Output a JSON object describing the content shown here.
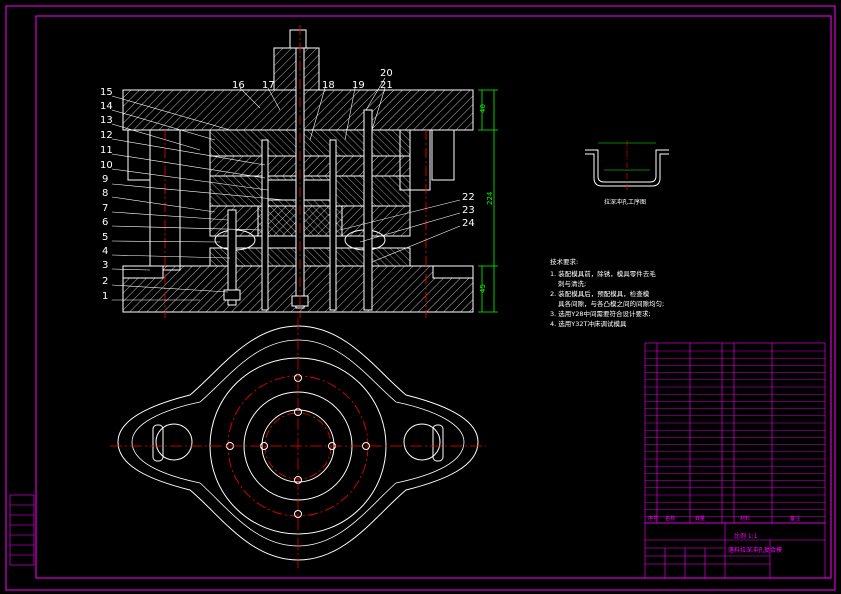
{
  "part_numbers_left": [
    "15",
    "14",
    "13",
    "12",
    "11",
    "10",
    "9",
    "8",
    "7",
    "6",
    "5",
    "4",
    "3",
    "2",
    "1"
  ],
  "part_numbers_top": [
    "16",
    "17",
    "18",
    "19",
    "20",
    "21"
  ],
  "part_numbers_right": [
    "22",
    "23",
    "24"
  ],
  "dimensions": {
    "upper": "40",
    "total": "224",
    "lower": "45"
  },
  "workpiece_caption": "拉深冲孔工序图",
  "tech_req": {
    "title": "技术要求:",
    "lines": [
      "1. 装配模具前，除锈，模具零件去毛",
      "刺与清洗;",
      "2. 装配模具后，预配模具，检查模",
      "具各间隙，与各凸模之间的间隙均匀;",
      "3. 选用Y28中间需要符合设计要求;",
      "4. 选用Y32T冲床调试模具"
    ]
  },
  "title_block": {
    "scale": "比例 1:1",
    "drawing_name": "落料拉深冲孔复合模",
    "header_cols": [
      "序号",
      "名称",
      "数量",
      "材料",
      "备注"
    ]
  },
  "colors": {
    "background": "#000000",
    "border": "#ff00ff",
    "lines": "#ffffff",
    "centerline": "#ff0000",
    "dimension": "#00ff00",
    "hatch": "#ffffff",
    "table_text": "#ff00ff",
    "leader": "#ffffff"
  }
}
